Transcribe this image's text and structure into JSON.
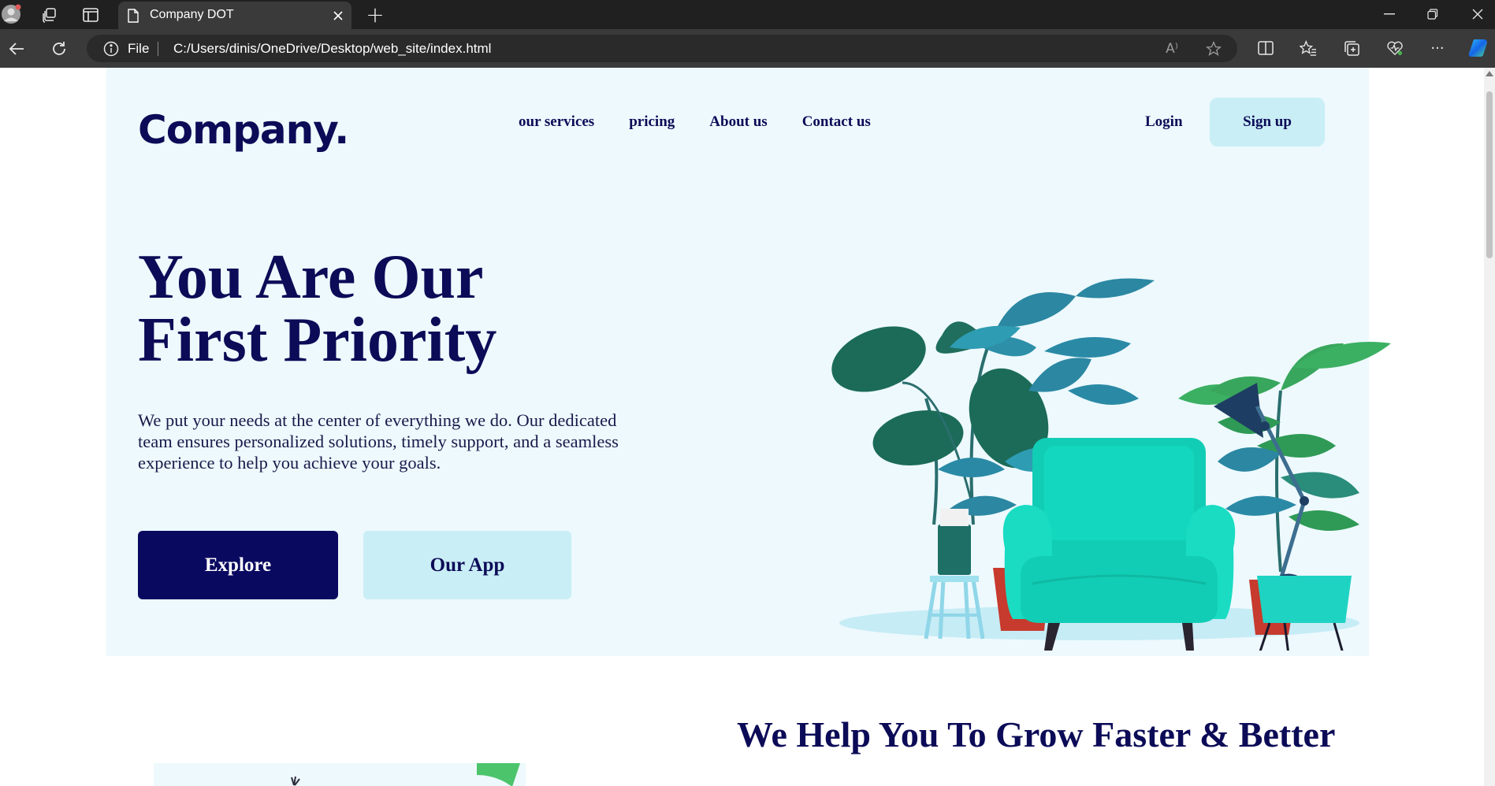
{
  "browser": {
    "tab_title": "Company DOT",
    "new_tab_symbol": "+",
    "address_prefix": "File",
    "address_url": "C:/Users/dinis/OneDrive/Desktop/web_site/index.html",
    "read_aloud_symbol": "A⁾",
    "more_symbol": "···"
  },
  "header": {
    "logo": "Company.",
    "nav": [
      {
        "label": "our services"
      },
      {
        "label": "pricing"
      },
      {
        "label": "About us"
      },
      {
        "label": "Contact us"
      }
    ],
    "login_label": "Login",
    "signup_label": "Sign up"
  },
  "hero": {
    "title_line1": "You Are Our",
    "title_line2": "First Priority",
    "description": "We put your needs at the center of everything we do. Our dedicated team ensures personalized solutions, timely support, and a seamless experience to help you achieve your goals.",
    "explore_label": "Explore",
    "app_label": "Our App"
  },
  "section": {
    "title": "We Help You To Grow Faster & Better"
  },
  "colors": {
    "brand_navy": "#0c0b57",
    "hero_bg": "#edf9fd",
    "accent_light": "#c9eef6",
    "chair": "#17d6bf"
  }
}
